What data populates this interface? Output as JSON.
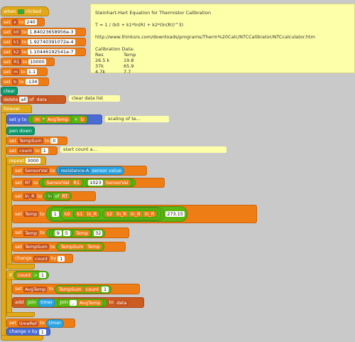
{
  "hat": {
    "when": "when",
    "flag_icon": "green-flag",
    "clicked": "clicked"
  },
  "init": [
    {
      "label": "set",
      "var": "x",
      "to": "to",
      "val": "240"
    },
    {
      "label": "set",
      "var": "k0",
      "to": "to",
      "val": "1.84023658956e-3"
    },
    {
      "label": "set",
      "var": "k1",
      "to": "to",
      "val": "1.92740391072e-4"
    },
    {
      "label": "set",
      "var": "k2",
      "to": "to",
      "val": "1.10446192541e-7"
    },
    {
      "label": "set",
      "var": "R1",
      "to": "to",
      "val": "10000"
    },
    {
      "label": "set",
      "var": "m",
      "to": "to",
      "val": "1.1"
    },
    {
      "label": "set",
      "var": "b",
      "to": "to",
      "val": "-134"
    }
  ],
  "clear": "clear",
  "delete": {
    "label": "delete",
    "idx": "all",
    "of": "of",
    "list": "data"
  },
  "forever": "forever",
  "sety": {
    "label": "set y to",
    "m": "m",
    "avg": "AvgTemp",
    "b": "b",
    "op1": "*",
    "op2": "+"
  },
  "pendown": "pen down",
  "tempsum": {
    "label": "set",
    "var": "TempSum",
    "to": "to",
    "val": "0"
  },
  "count": {
    "label": "set",
    "var": "count",
    "to": "to",
    "val": "1"
  },
  "repeat": {
    "label": "repeat",
    "val": "3000"
  },
  "sensorval": {
    "label": "set",
    "var": "SensorVal",
    "to": "to",
    "sensor": "resistance-A",
    "value": "sensor value"
  },
  "rt": {
    "label": "set",
    "var": "RT",
    "to": "to",
    "sv": "SensorVal",
    "r1": "R1",
    "n": "1023",
    "sv2": "SensorVal"
  },
  "lnr": {
    "label": "set",
    "var": "ln_R",
    "to": "to",
    "fn": "ln",
    "of": "of",
    "rt": "RT"
  },
  "temp1": {
    "label": "set",
    "var": "Temp",
    "to": "to",
    "one": "1",
    "k0": "k0",
    "k1": "k1",
    "lnr": "ln_R",
    "k2": "k2",
    "lnr2": "ln_R",
    "lnr3": "ln_R",
    "lnr4": "ln_R",
    "c": "273.15"
  },
  "temp2": {
    "label": "set",
    "var": "Temp",
    "to": "to",
    "a": "9",
    "b": "5",
    "temp": "Temp",
    "c": "32"
  },
  "tempsum2": {
    "label": "set",
    "var": "TempSum",
    "to": "to",
    "ts": "TempSum",
    "temp": "Temp"
  },
  "changecount": {
    "label": "change",
    "var": "count",
    "by": "by",
    "val": "1"
  },
  "ifblock": {
    "label": "if",
    "var": "count",
    "op": ">",
    "val": "1"
  },
  "avgtemp": {
    "label": "set",
    "var": "AvgTemp",
    "to": "to",
    "ts": "TempSum",
    "cnt": "count",
    "extra": "1"
  },
  "addblock": {
    "label": "add",
    "join": "join",
    "timer": "timer",
    "join2": "join",
    "comma": ",",
    "avg": "AvgTemp",
    "to": "to",
    "list": "data"
  },
  "setreturn": {
    "label": "set",
    "var": "timeRef",
    "to": "to",
    "val": "timer"
  },
  "changex": {
    "label": "change x by",
    "val": "1"
  },
  "comments": {
    "main": {
      "title": "Steinhart-Hart Equation for Thermistor Calibration",
      "eq": "T = 1 / (k0 + k1*ln(R) + k2*(ln(R))^3)",
      "url": "http://www.thinksrs.com/downloads/programs/Therm%20Calc/NTCCalibrator/NTCcalculator.htm",
      "cal": "Calibration Data:",
      "h1": "Res",
      "h2": "Temp",
      "rows": [
        [
          "26.5 k",
          "19.8"
        ],
        [
          "37k",
          "65.9"
        ],
        [
          "4.7k",
          "7.7"
        ]
      ]
    },
    "clear_data": "clear data list",
    "scaling": "scaling of te...",
    "start_count": "start count a..."
  }
}
